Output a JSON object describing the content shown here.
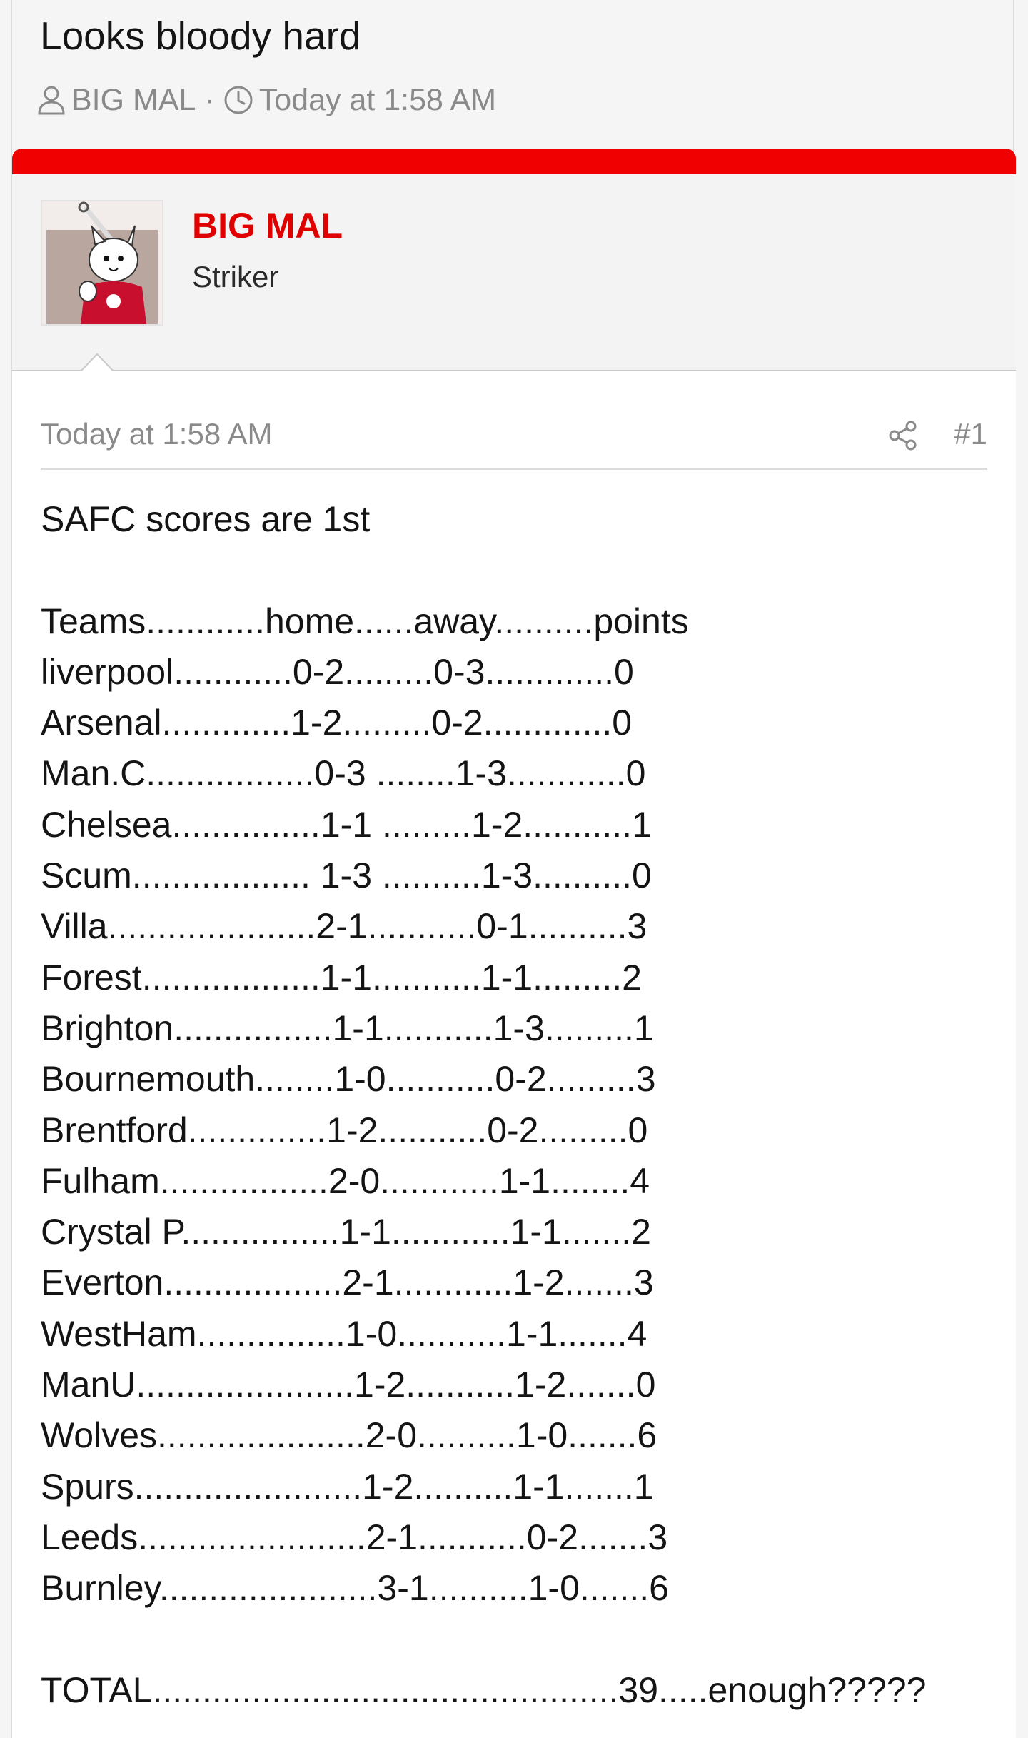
{
  "thread": {
    "title": "Looks bloody hard",
    "author": "BIG MAL",
    "separator": "·",
    "time": "Today at 1:58 AM"
  },
  "post": {
    "username": "BIG MAL",
    "user_title": "Striker",
    "date": "Today at 1:58 AM",
    "number": "#1",
    "intro": "SAFC scores are 1st",
    "lines": [
      "Teams............home......away..........points",
      "liverpool............0-2.........0-3.............0",
      "Arsenal.............1-2.........0-2.............0",
      "Man.C.................0-3 ........1-3............0",
      "Chelsea...............1-1 .........1-2...........1",
      "Scum.................. 1-3 ..........1-3..........0",
      "Villa.....................2-1...........0-1..........3",
      "Forest..................1-1...........1-1.........2",
      "Brighton................1-1...........1-3.........1",
      "Bournemouth........1-0...........0-2.........3",
      "Brentford..............1-2...........0-2.........0",
      "Fulham.................2-0............1-1........4",
      "Crystal P................1-1............1-1.......2",
      "Everton..................2-1............1-2.......3",
      "WestHam...............1-0...........1-1.......4",
      "ManU......................1-2...........1-2.......0",
      "Wolves.....................2-0..........1-0.......6",
      "Spurs.......................1-2..........1-1.......1",
      "Leeds.......................2-1...........0-2.......3",
      "Burnley......................3-1..........1-0.......6"
    ],
    "total": "TOTAL...............................................39.....enough?????"
  },
  "icons": {
    "author": "user-icon",
    "time": "clock-icon",
    "share": "share-icon",
    "avatar": "avatar-image"
  },
  "colors": {
    "accent": "#f00000",
    "username": "#e00000",
    "muted": "#8a8a8a"
  }
}
